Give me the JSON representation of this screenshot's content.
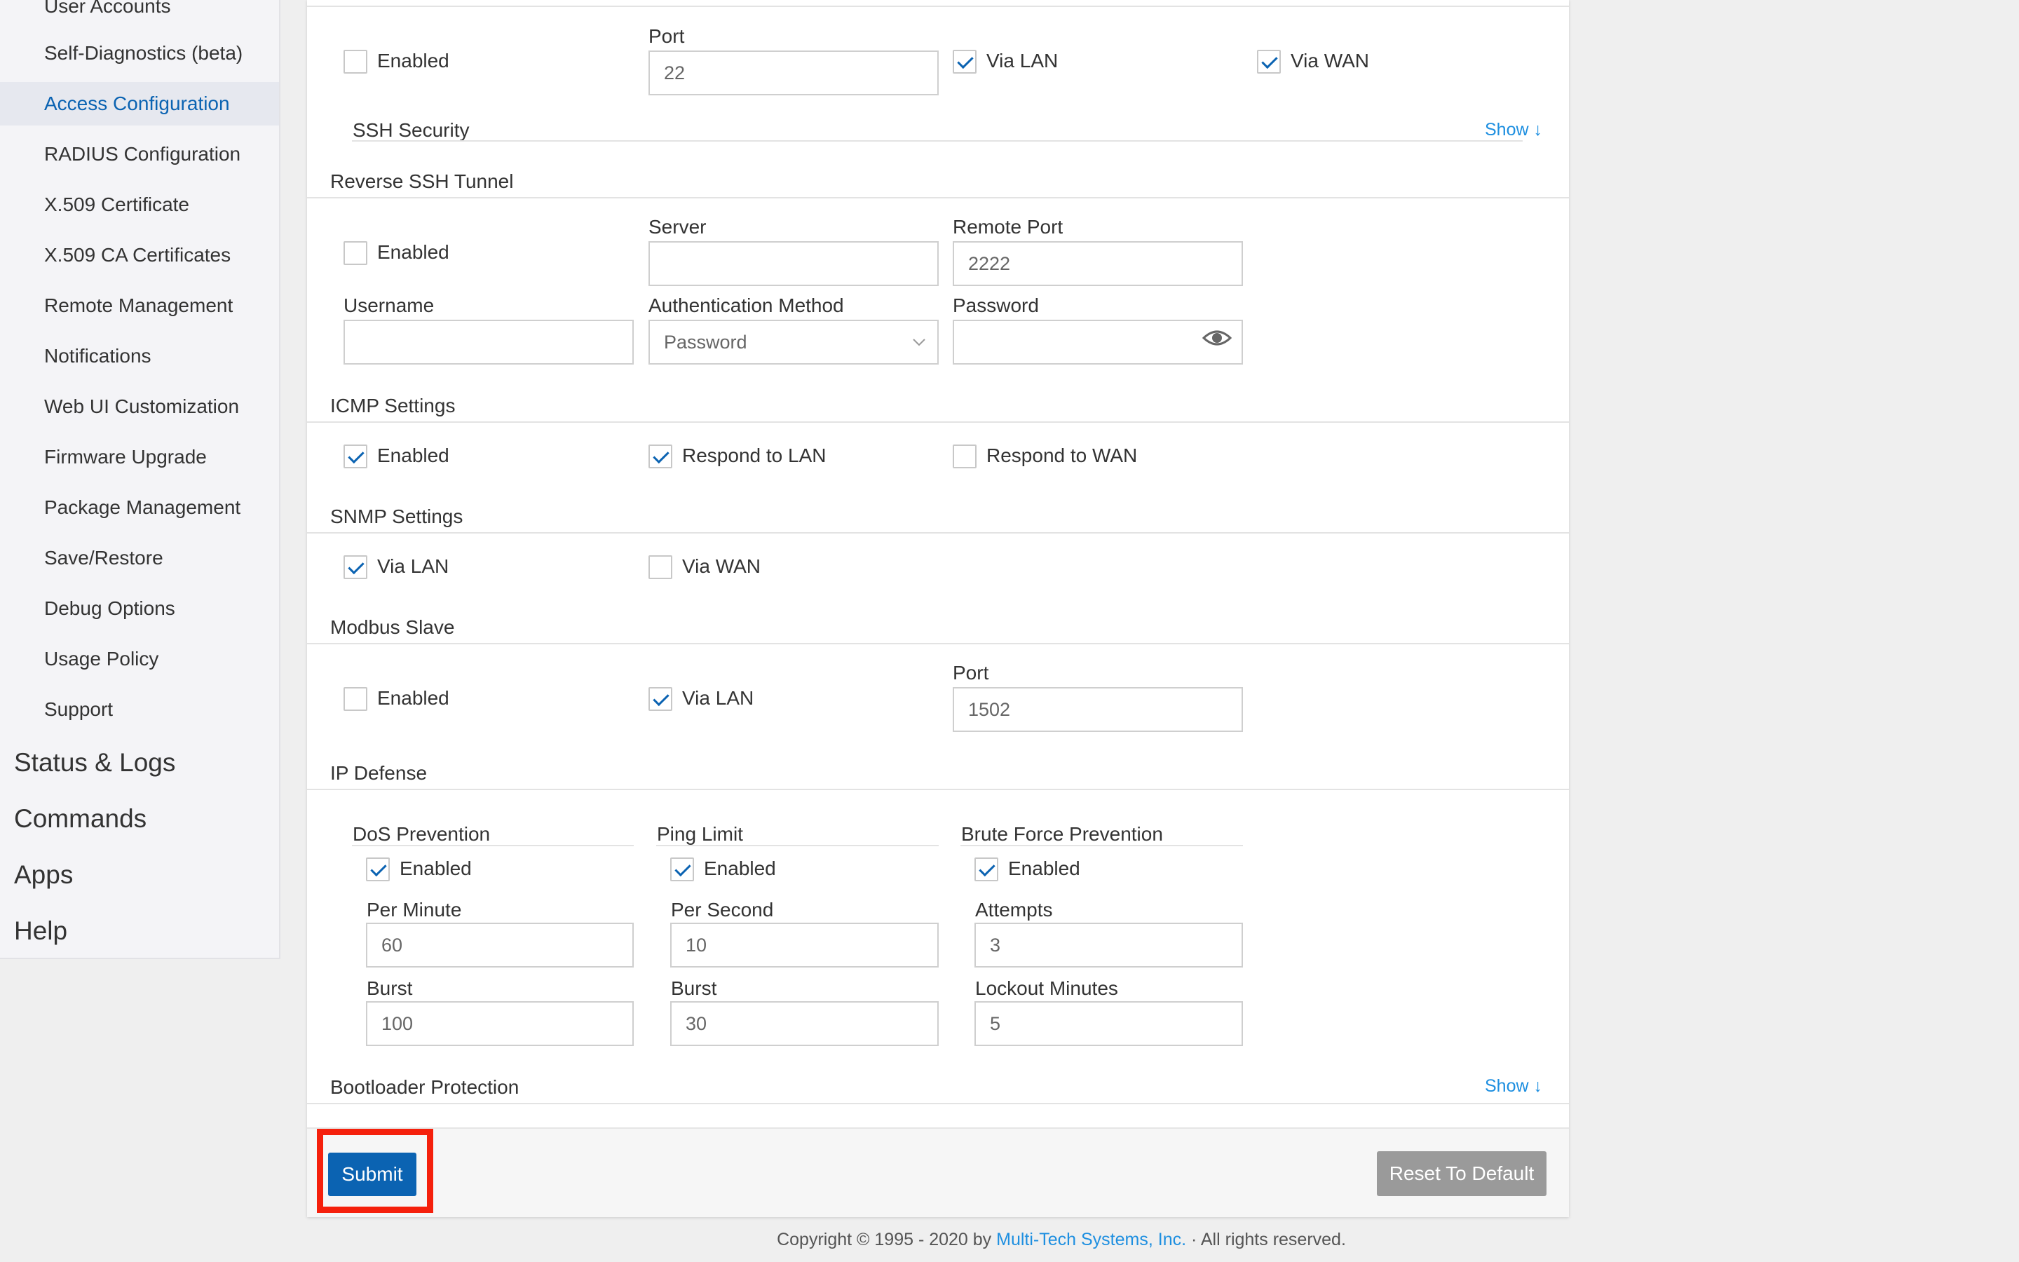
{
  "sidebar": {
    "items": [
      {
        "label": "User Accounts"
      },
      {
        "label": "Self-Diagnostics (beta)"
      },
      {
        "label": "Access Configuration"
      },
      {
        "label": "RADIUS Configuration"
      },
      {
        "label": "X.509 Certificate"
      },
      {
        "label": "X.509 CA Certificates"
      },
      {
        "label": "Remote Management"
      },
      {
        "label": "Notifications"
      },
      {
        "label": "Web UI Customization"
      },
      {
        "label": "Firmware Upgrade"
      },
      {
        "label": "Package Management"
      },
      {
        "label": "Save/Restore"
      },
      {
        "label": "Debug Options"
      },
      {
        "label": "Usage Policy"
      },
      {
        "label": "Support"
      }
    ],
    "top_items": [
      {
        "label": "Status & Logs"
      },
      {
        "label": "Commands"
      },
      {
        "label": "Apps"
      },
      {
        "label": "Help"
      }
    ]
  },
  "ssh": {
    "enabled_label": "Enabled",
    "port_label": "Port",
    "port_value": "22",
    "via_lan_label": "Via LAN",
    "via_wan_label": "Via WAN",
    "security_title": "SSH Security",
    "show_label": "Show ↓"
  },
  "reverse_ssh": {
    "title": "Reverse SSH Tunnel",
    "enabled_label": "Enabled",
    "server_label": "Server",
    "server_value": "",
    "remote_port_label": "Remote Port",
    "remote_port_value": "2222",
    "username_label": "Username",
    "username_value": "",
    "auth_label": "Authentication Method",
    "auth_value": "Password",
    "password_label": "Password",
    "password_value": ""
  },
  "icmp": {
    "title": "ICMP Settings",
    "enabled_label": "Enabled",
    "lan_label": "Respond to LAN",
    "wan_label": "Respond to WAN"
  },
  "snmp": {
    "title": "SNMP Settings",
    "lan_label": "Via LAN",
    "wan_label": "Via WAN"
  },
  "modbus": {
    "title": "Modbus Slave",
    "enabled_label": "Enabled",
    "lan_label": "Via LAN",
    "port_label": "Port",
    "port_value": "1502"
  },
  "ip_defense": {
    "title": "IP Defense",
    "dos": {
      "title": "DoS Prevention",
      "enabled_label": "Enabled",
      "rate_label": "Per Minute",
      "rate_value": "60",
      "burst_label": "Burst",
      "burst_value": "100"
    },
    "ping": {
      "title": "Ping Limit",
      "enabled_label": "Enabled",
      "rate_label": "Per Second",
      "rate_value": "10",
      "burst_label": "Burst",
      "burst_value": "30"
    },
    "brute": {
      "title": "Brute Force Prevention",
      "enabled_label": "Enabled",
      "attempts_label": "Attempts",
      "attempts_value": "3",
      "lockout_label": "Lockout Minutes",
      "lockout_value": "5"
    }
  },
  "bootloader": {
    "title": "Bootloader Protection",
    "show_label": "Show ↓"
  },
  "actions": {
    "submit_label": "Submit",
    "reset_label": "Reset To Default"
  },
  "footer": {
    "prefix": "Copyright © 1995 - 2020 by ",
    "company": "Multi-Tech Systems, Inc.",
    "suffix": " · All rights reserved."
  }
}
